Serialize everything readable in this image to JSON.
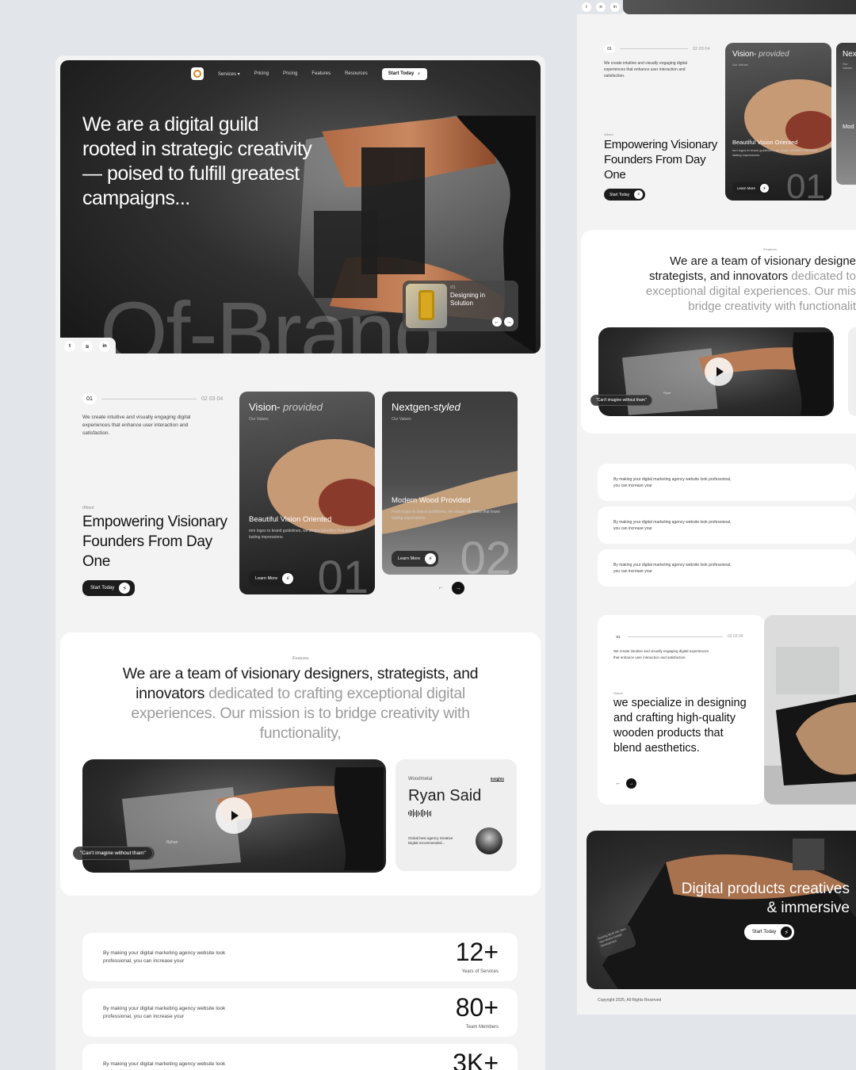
{
  "colors": {
    "accent": "#e08a1d",
    "dark": "#1c1c1c",
    "canvas": "#e2e5ea"
  },
  "hero": {
    "nav": {
      "services": "Services",
      "pricing1": "Pricing",
      "pricing2": "Pricing",
      "features": "Features",
      "resources": "Resources",
      "cta": "Start Today"
    },
    "headline": "We are a digital guild rooted in strategic creativity — poised to fulfill greatest campaigns...",
    "watermark": "Of-Brand",
    "solution": {
      "number": "/01",
      "title": "Designing in Solution"
    },
    "socials": [
      "twitter-icon",
      "spotify-icon",
      "linkedin-icon"
    ]
  },
  "about": {
    "counter_active": "01",
    "counter_rest": "02  03  04",
    "intro": "We create intuitive and visually engaging digital experiences that enhance user interaction and satisfaction.",
    "tag": "/About",
    "title": "Empowering Visionary Founders From Day One",
    "cta": "Start Today",
    "cards": [
      {
        "title_plain": "Vision-",
        "title_em": "provided",
        "sub": "Our Values",
        "heading": "Beautiful Vision Oriented",
        "text": "mm logos to brand guidelines, we shape identities that leave lasting impressions.",
        "button": "Learn More",
        "number": "01"
      },
      {
        "title_plain": "Nextgen-",
        "title_em": "styled",
        "sub": "Our Values",
        "heading": "Modern Wood Provided",
        "text": "From logos to brand guidelines, we shape identities that leave lasting impressions.",
        "button": "Learn More",
        "number": "02"
      }
    ]
  },
  "team": {
    "tag": "/Features",
    "statement_dark": "We are a team of visionary designers, strategists, and innovators",
    "statement_grey": "dedicated to crafting exceptional digital experiences. Our mission is to bridge creativity with functionality,",
    "video_name": "Ryhan",
    "quote": "\"Can't imagine without tham\"",
    "ryan": {
      "label": "Woodmetal",
      "link": "Insights",
      "name": "Ryan Said",
      "desc": "Global best agency Sreative Digital recommended..."
    }
  },
  "stats": [
    {
      "text": "By making your digital marketing agency website look professional, you can increase your",
      "value": "12+",
      "label": "Years of Services"
    },
    {
      "text": "By making your digital marketing agency website look professional, you can increase your",
      "value": "80+",
      "label": "Team Members"
    },
    {
      "text": "By making your digital marketing agency website look professional, you can increase your",
      "value": "3K+",
      "label": ""
    }
  ],
  "right": {
    "about": {
      "counter_active": "01",
      "counter_rest": "02  03  04",
      "intro": "We create intuitive and visually engaging digital experiences that enhance user interaction and satisfaction.",
      "tag": "/About",
      "title": "Empowering Visionary Founders From Day One",
      "cta": "Start Today",
      "card": {
        "title_plain": "Vision-",
        "title_em": "provided",
        "sub": "Our Values",
        "heading": "Beautiful Vision Oriented",
        "text": "mm logos to brand guidelines, we shape identities that leave lasting impressions.",
        "button": "Learn More",
        "number": "01"
      },
      "card2_title": "Nex",
      "card2_sub": "Our Values",
      "card2_heading": "Mod"
    },
    "team": {
      "tag": "/Features",
      "line1": "We are a team of visionary designe",
      "line2_dark": "strategists, and innovators",
      "line2_grey": "dedicated to",
      "line3": "exceptional digital experiences. Our mis",
      "line4": "bridge creativity with functionalit",
      "video_name": "Ryan",
      "quote": "\"Can't imagine without tham\""
    },
    "stats": [
      "By making your digital marketing agency website look professional, you can increase your",
      "By making your digital marketing agency website look professional, you can increase your",
      "By making your digital marketing agency website look professional, you can increase your"
    ],
    "spec": {
      "counter_active": "01",
      "counter_rest": "02  03  04",
      "intro": "We create intuitive and visually engaging digital experiences that enhance user interaction and satisfaction.",
      "tag": "/About",
      "title": "we specialize in designing and crafting high-quality wooden products that blend aesthetics."
    },
    "cta": {
      "title": "Digital products creatives & immersive",
      "button": "Start Today",
      "badge": "Exciting Work Her. Next Gen Motion Design Development"
    },
    "copyright": "Copyright 2025, All Rights Reserved"
  }
}
